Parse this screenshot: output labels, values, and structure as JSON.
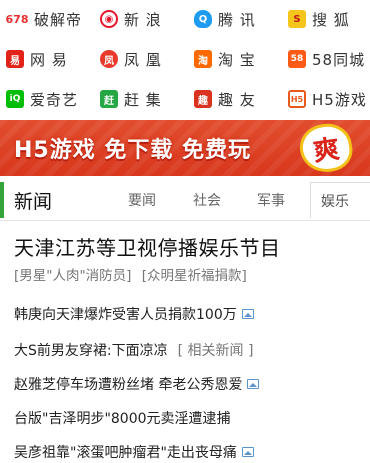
{
  "sites": [
    {
      "label": "破解帝",
      "icon": "pojiedi-icon",
      "color": "#ffffff",
      "text": "678",
      "textColor": "#e6312f"
    },
    {
      "label": "新 浪",
      "icon": "sina-weibo-icon",
      "color": "#e6162d",
      "text": "◉",
      "textColor": "#ffffff"
    },
    {
      "label": "腾 讯",
      "icon": "tencent-qq-icon",
      "color": "#1d9bf0",
      "text": "Q",
      "textColor": "#ffffff"
    },
    {
      "label": "搜 狐",
      "icon": "sohu-icon",
      "color": "#f5c51b",
      "text": "S",
      "textColor": "#c0161a"
    },
    {
      "label": "网 易",
      "icon": "netease-icon",
      "color": "#e2231a",
      "text": "易",
      "textColor": "#ffffff"
    },
    {
      "label": "凤 凰",
      "icon": "ifeng-icon",
      "color": "#e83a2a",
      "text": "凤",
      "textColor": "#ffffff"
    },
    {
      "label": "淘 宝",
      "icon": "taobao-icon",
      "color": "#ff6a00",
      "text": "淘",
      "textColor": "#ffffff"
    },
    {
      "label": "58同城",
      "icon": "58tongcheng-icon",
      "color": "#ff5a16",
      "text": "58",
      "textColor": "#ffffff"
    },
    {
      "label": "爱奇艺",
      "icon": "iqiyi-icon",
      "color": "#00be06",
      "text": "iQ",
      "textColor": "#ffffff"
    },
    {
      "label": "赶 集",
      "icon": "ganji-icon",
      "color": "#25a744",
      "text": "赶",
      "textColor": "#ffffff"
    },
    {
      "label": "趣 友",
      "icon": "quyou-icon",
      "color": "#d9331f",
      "text": "趣",
      "textColor": "#ffffff"
    },
    {
      "label": "H5游戏",
      "icon": "h5-game-icon",
      "color": "#ffffff",
      "text": "H5",
      "textColor": "#e8591a"
    }
  ],
  "banner": {
    "text": "H5游戏 免下载 免费玩",
    "badge": "爽",
    "bg": "#dd3f22"
  },
  "tabs": {
    "active": "新闻",
    "items": [
      "要闻",
      "社会",
      "军事"
    ],
    "boxed": "娱乐",
    "accent": "#35a33a"
  },
  "headline": {
    "title": "天津江苏等卫视停播娱乐节目",
    "sub1": "[男星\"人肉\"消防员]",
    "sub2": "[众明星祈福捐款]"
  },
  "news": [
    {
      "text": "韩庚向天津爆炸受害人员捐款100万",
      "hasImage": true,
      "related": ""
    },
    {
      "text": "大S前男友穿裙:下面凉凉",
      "hasImage": false,
      "related": "[ 相关新闻 ]"
    },
    {
      "text": "赵雅芝停车场遭粉丝堵 牵老公秀恩爱",
      "hasImage": true,
      "related": ""
    },
    {
      "text": "台版\"吉泽明步\"8000元卖淫遭逮捕",
      "hasImage": false,
      "related": ""
    },
    {
      "text": "吴彦祖靠\"滚蛋吧肿瘤君\"走出丧母痛",
      "hasImage": true,
      "related": ""
    }
  ]
}
